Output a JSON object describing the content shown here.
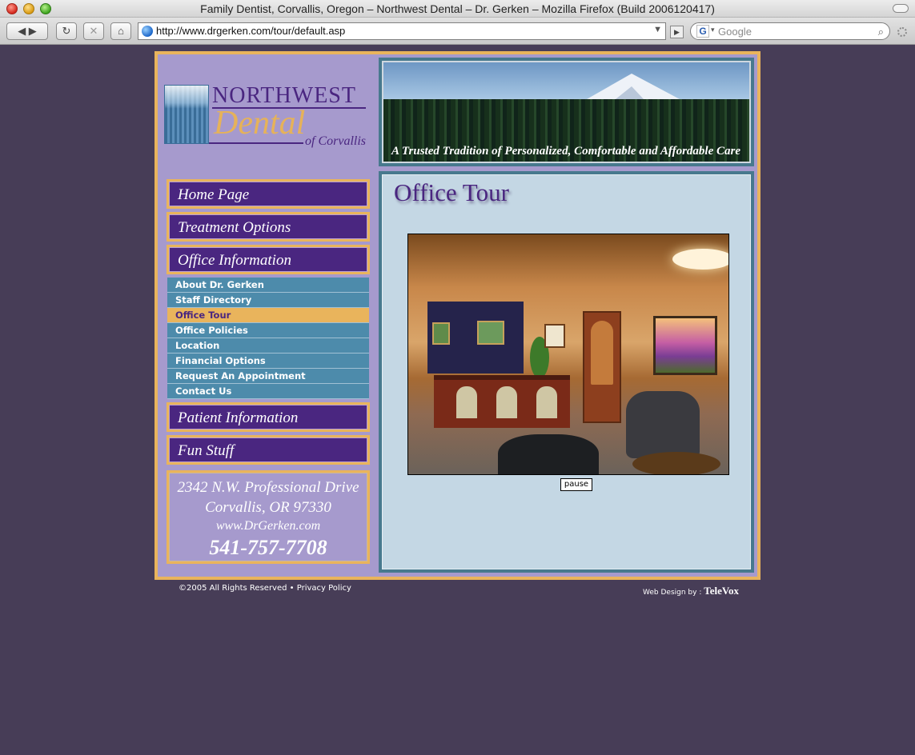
{
  "browser": {
    "window_title": "Family Dentist, Corvallis, Oregon – Northwest Dental – Dr. Gerken – Mozilla Firefox (Build 2006120417)",
    "url": "http://www.drgerken.com/tour/default.asp",
    "search_placeholder": "Google",
    "buttons": {
      "back": "◀ ▶",
      "reload": "↻",
      "stop": "✕",
      "home": "⌂",
      "go": "▶"
    }
  },
  "logo": {
    "line1": "NORTHWEST",
    "line2": "Dental",
    "line3": "of Corvallis"
  },
  "banner": {
    "tagline": "A Trusted Tradition of Personalized, Comfortable  and Affordable Care"
  },
  "nav": {
    "main": [
      "Home Page",
      "Treatment Options",
      "Office Information",
      "Patient Information",
      "Fun Stuff"
    ],
    "office_submenu": [
      "About Dr. Gerken",
      "Staff Directory",
      "Office Tour",
      "Office Policies",
      "Location",
      "Financial Options",
      "Request An Appointment",
      "Contact Us"
    ],
    "active_item": "Office Tour"
  },
  "address": {
    "street": "2342 N.W. Professional Drive",
    "city": "Corvallis, OR 97330",
    "website": "www.DrGerken.com",
    "phone": "541-757-7708"
  },
  "content": {
    "title": "Office Tour",
    "slideshow_button": "pause"
  },
  "footer": {
    "copyright": "©2005 All Rights Reserved •",
    "privacy": "Privacy Policy",
    "design_by": "Web Design by :",
    "designer": "TeleVox"
  },
  "colors": {
    "page_bg": "#473d57",
    "purple": "#4a2680",
    "gold": "#e9b45c",
    "lavender": "#a69acd",
    "teal": "#4d8bab",
    "content_bg": "#c4d7e4"
  }
}
